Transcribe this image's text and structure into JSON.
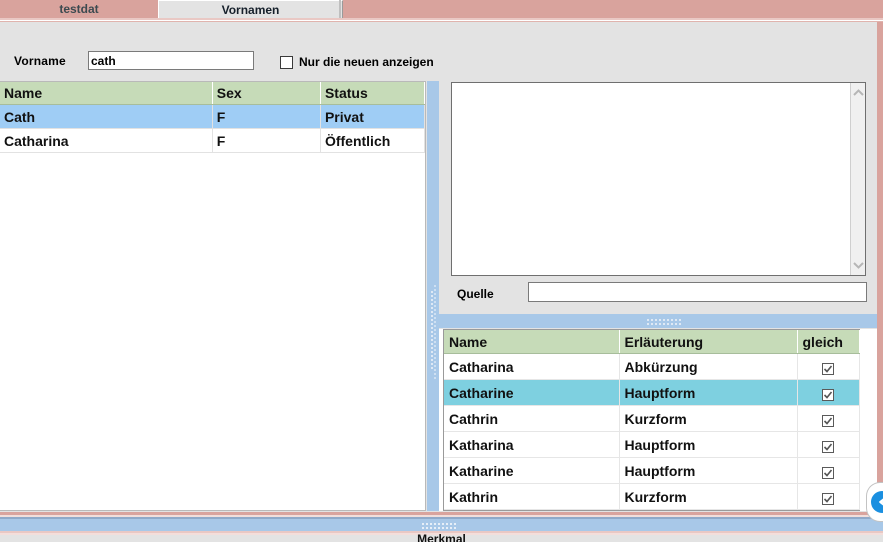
{
  "tabs": [
    {
      "label": "testdat",
      "active": false
    },
    {
      "label": "Vornamen",
      "active": true
    }
  ],
  "form": {
    "vorname_label": "Vorname",
    "vorname_value": "cath",
    "vorname_placeholder": "",
    "only_new_label": "Nur die neuen anzeigen",
    "only_new_checked": false
  },
  "left_grid": {
    "columns": [
      "Name",
      "Sex",
      "Status"
    ],
    "rows": [
      {
        "name": "Cath",
        "sex": "F",
        "status": "Privat",
        "selected": true
      },
      {
        "name": "Catharina",
        "sex": "F",
        "status": "Öffentlich",
        "selected": false
      }
    ]
  },
  "memo": {
    "value": "",
    "scroll_up_icon": "chevron-up-icon",
    "scroll_down_icon": "chevron-down-icon"
  },
  "quelle": {
    "label": "Quelle",
    "value": "",
    "placeholder": ""
  },
  "detail_grid": {
    "columns": [
      "Name",
      "Erläuterung",
      "gleich"
    ],
    "rows": [
      {
        "name": "Catharina",
        "erlaeuterung": "Abkürzung",
        "gleich": true,
        "selected": false
      },
      {
        "name": "Catharine",
        "erlaeuterung": "Hauptform",
        "gleich": true,
        "selected": true
      },
      {
        "name": "Cathrin",
        "erlaeuterung": "Kurzform",
        "gleich": true,
        "selected": false
      },
      {
        "name": "Katharina",
        "erlaeuterung": "Hauptform",
        "gleich": true,
        "selected": false
      },
      {
        "name": "Katharine",
        "erlaeuterung": "Hauptform",
        "gleich": true,
        "selected": false
      },
      {
        "name": "Kathrin",
        "erlaeuterung": "Kurzform",
        "gleich": true,
        "selected": false
      }
    ]
  },
  "footer": {
    "label": "Merkmal"
  },
  "side_toggle": {
    "icon": "arrow-left-circle-icon"
  },
  "colors": {
    "window_chrome": "#d9a39d",
    "panel_background": "#e3e3e3",
    "grid_header": "#c6dbb8",
    "row_selected_blue": "#9fcdf5",
    "row_selected_cyan": "#7ed0e0",
    "splitter": "#a8c8e8",
    "accent_blue": "#1a8fe0"
  }
}
